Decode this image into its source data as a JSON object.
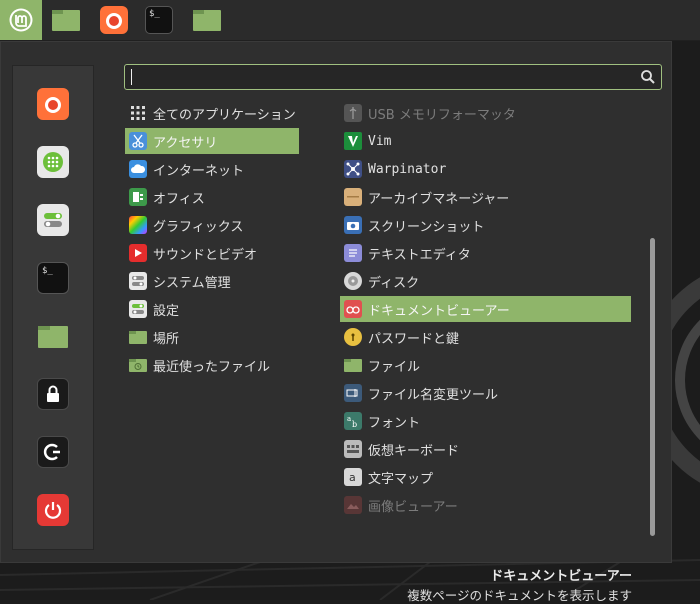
{
  "search": {
    "value": "",
    "placeholder": ""
  },
  "categories": [
    {
      "label": "全てのアプリケーション",
      "icon": "grid-icon"
    },
    {
      "label": "アクセサリ",
      "icon": "scissors-icon",
      "selected": true
    },
    {
      "label": "インターネット",
      "icon": "cloud-icon"
    },
    {
      "label": "オフィス",
      "icon": "office-icon"
    },
    {
      "label": "グラフィックス",
      "icon": "graphics-icon"
    },
    {
      "label": "サウンドとビデオ",
      "icon": "play-icon"
    },
    {
      "label": "システム管理",
      "icon": "toggle-icon"
    },
    {
      "label": "設定",
      "icon": "settings-toggle-icon"
    },
    {
      "label": "場所",
      "icon": "folder-icon"
    },
    {
      "label": "最近使ったファイル",
      "icon": "recent-folder-icon"
    }
  ],
  "apps": [
    {
      "label": "USB メモリフォーマッタ",
      "icon": "usb-icon",
      "dim": true
    },
    {
      "label": "Vim",
      "icon": "vim-icon"
    },
    {
      "label": "Warpinator",
      "icon": "warpinator-icon"
    },
    {
      "label": "アーカイブマネージャー",
      "icon": "archive-icon"
    },
    {
      "label": "スクリーンショット",
      "icon": "camera-icon"
    },
    {
      "label": "テキストエディタ",
      "icon": "text-editor-icon"
    },
    {
      "label": "ディスク",
      "icon": "disk-icon"
    },
    {
      "label": "ドキュメントビューアー",
      "icon": "document-viewer-icon",
      "selected": true
    },
    {
      "label": "パスワードと鍵",
      "icon": "key-icon"
    },
    {
      "label": "ファイル",
      "icon": "folder-icon"
    },
    {
      "label": "ファイル名変更ツール",
      "icon": "rename-icon"
    },
    {
      "label": "フォント",
      "icon": "font-icon"
    },
    {
      "label": "仮想キーボード",
      "icon": "keyboard-icon"
    },
    {
      "label": "文字マップ",
      "icon": "charmap-icon"
    },
    {
      "label": "画像ビューアー",
      "icon": "image-viewer-icon",
      "dim": true
    }
  ],
  "description": {
    "title": "ドキュメントビューアー",
    "text": "複数ページのドキュメントを表示します"
  },
  "terminal_glyph": "$_",
  "colors": {
    "accent": "#8fb56a",
    "panel": "#2b2b2b",
    "menu": "#2f2f2f"
  }
}
